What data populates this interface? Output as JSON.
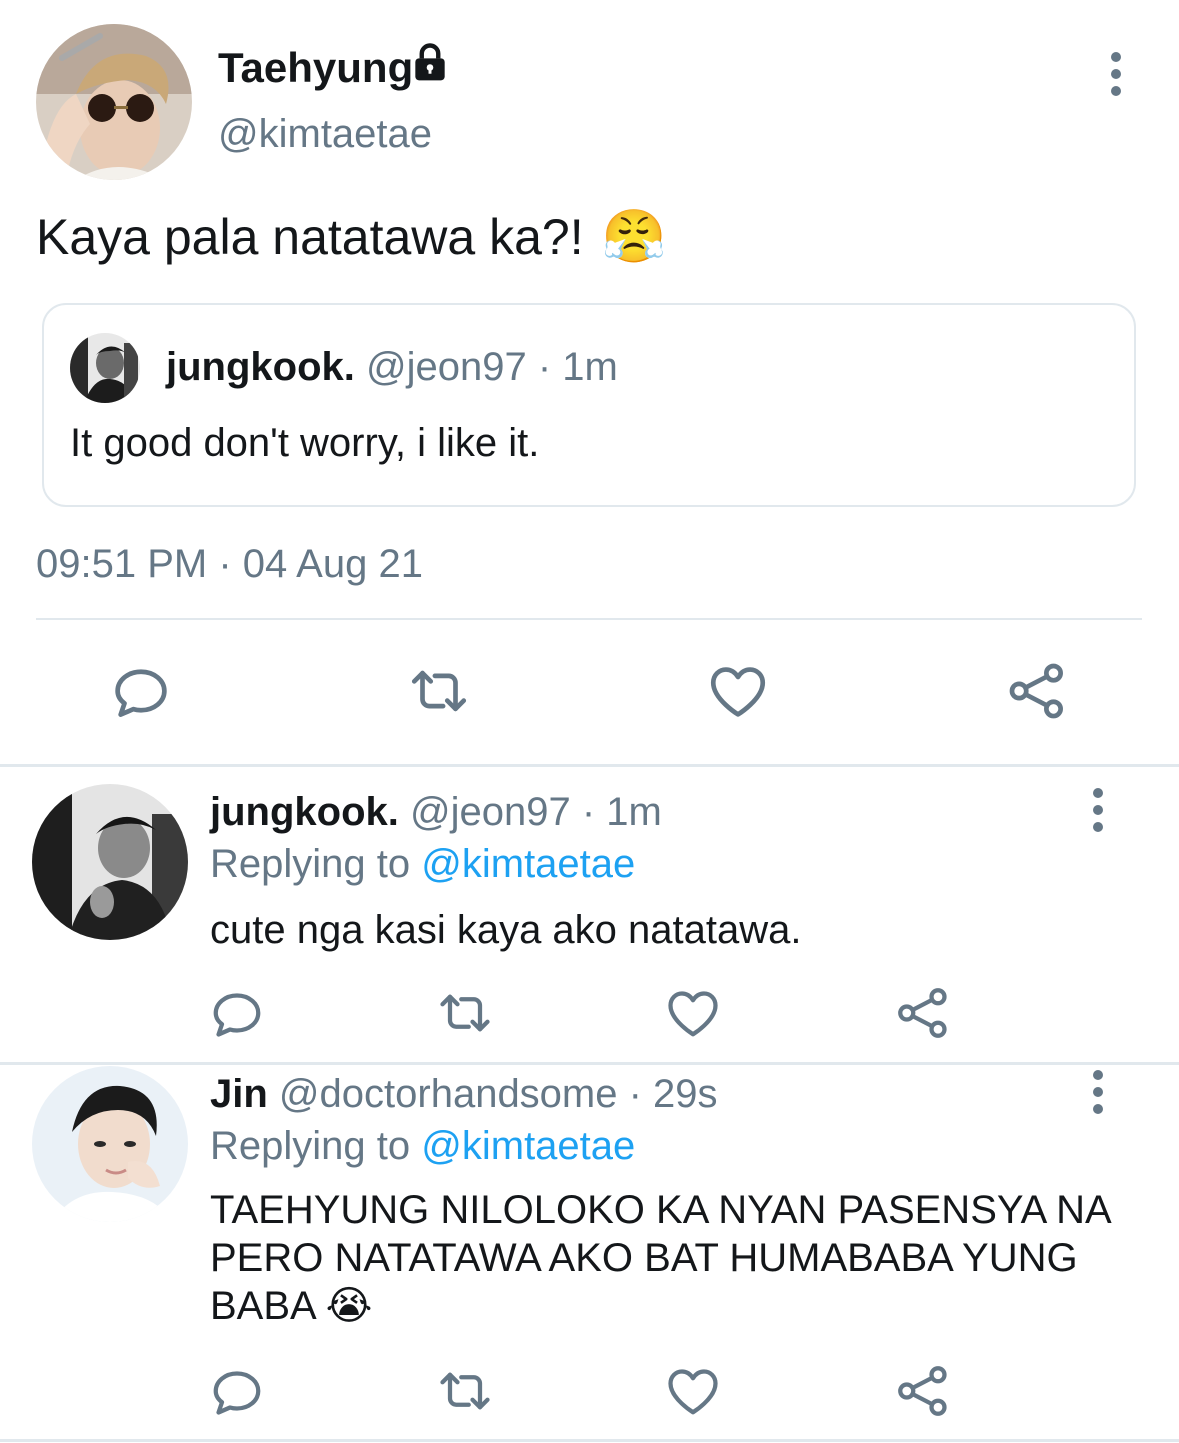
{
  "main_tweet": {
    "display_name": "Taehyung",
    "handle": "@kimtaetae",
    "text": "Kaya pala natatawa ka?!",
    "emoji": "😤",
    "timestamp": "09:51 PM · 04 Aug 21",
    "quote": {
      "display_name": "jungkook.",
      "handle": "@jeon97",
      "time": "· 1m",
      "text": "It good don't worry, i like it."
    }
  },
  "replies": [
    {
      "display_name": "jungkook.",
      "handle": "@jeon97",
      "time": "· 1m",
      "replying_label": "Replying to",
      "replying_to": "@kimtaetae",
      "text": "cute nga kasi kaya ako natatawa."
    },
    {
      "display_name": "Jin",
      "handle": "@doctorhandsome",
      "time": "· 29s",
      "replying_label": "Replying to",
      "replying_to": "@kimtaetae",
      "text_lines": [
        "TAEHYUNG NILOLOKO KA NYAN PASENSYA NA",
        "PERO NATATAWA AKO BAT HUMABABA YUNG",
        "BABA"
      ],
      "emoji": "😭"
    }
  ],
  "colors": {
    "text": "#14171a",
    "secondary": "#657786",
    "accent": "#1da1f2",
    "divider": "#e1e8ed"
  },
  "icons": [
    "lock-icon",
    "more-icon",
    "reply-icon",
    "retweet-icon",
    "like-icon",
    "share-icon"
  ]
}
